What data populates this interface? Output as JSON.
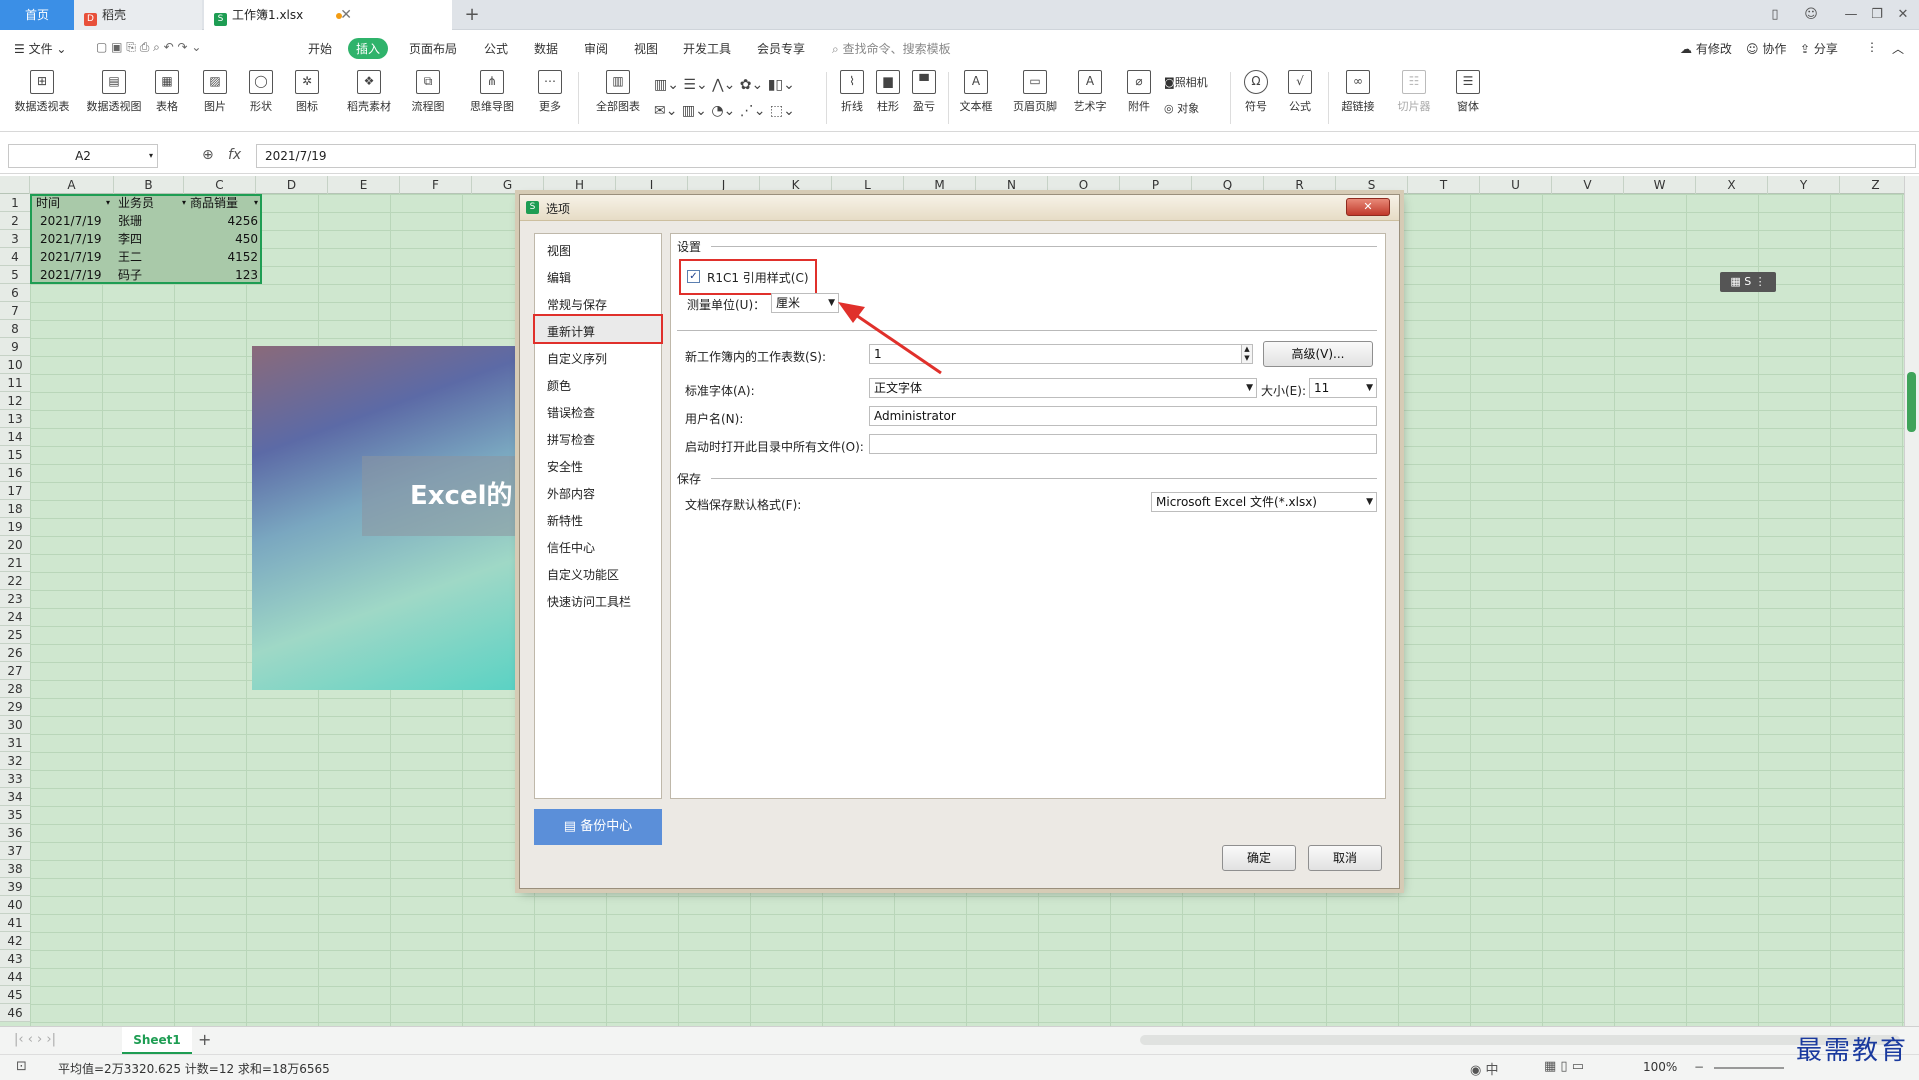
{
  "tabs": {
    "home": "首页",
    "daoke": "稻壳",
    "workbook": "工作簿1.xlsx"
  },
  "menu": {
    "file": "文件",
    "items": [
      "开始",
      "插入",
      "页面布局",
      "公式",
      "数据",
      "审阅",
      "视图",
      "开发工具",
      "会员专享"
    ],
    "search_placeholder": "查找命令、搜索模板",
    "has_changes": "有修改",
    "collab": "协作",
    "share": "分享"
  },
  "ribbon": [
    "数据透视表",
    "数据透视图",
    "表格",
    "图片",
    "形状",
    "图标",
    "稻壳素材",
    "流程图",
    "思维导图",
    "更多",
    "全部图表",
    "折线",
    "柱形",
    "盈亏",
    "文本框",
    "页眉页脚",
    "艺术字",
    "附件",
    "照相机",
    "对象",
    "符号",
    "公式",
    "超链接",
    "切片器",
    "窗体"
  ],
  "formula": {
    "cell_ref": "A2",
    "fx": "fx",
    "value": "2021/7/19"
  },
  "columns": [
    "A",
    "B",
    "C",
    "D",
    "E",
    "F",
    "G",
    "H",
    "I",
    "J",
    "K",
    "L",
    "M",
    "N",
    "O",
    "P",
    "Q",
    "R",
    "S",
    "T",
    "U",
    "V",
    "W",
    "X",
    "Y",
    "Z"
  ],
  "rows": [
    "1",
    "2",
    "3",
    "4",
    "5",
    "6",
    "7",
    "8",
    "9",
    "10",
    "11",
    "12",
    "13",
    "14",
    "15",
    "16",
    "17",
    "18",
    "19",
    "20",
    "21",
    "22",
    "23",
    "24",
    "25",
    "26",
    "27",
    "28",
    "29",
    "30",
    "31",
    "32",
    "33",
    "34",
    "35",
    "36",
    "37",
    "38",
    "39",
    "40",
    "41",
    "42",
    "43",
    "44",
    "45",
    "46"
  ],
  "table": {
    "headers": [
      "时间",
      "业务员",
      "商品销量"
    ],
    "data": [
      [
        "2021/7/19",
        "张珊",
        "4256"
      ],
      [
        "2021/7/19",
        "李四",
        "450"
      ],
      [
        "2021/7/19",
        "王二",
        "4152"
      ],
      [
        "2021/7/19",
        "码子",
        "123"
      ]
    ]
  },
  "picture_text": "Excel的",
  "sheet_tab": "Sheet1",
  "status": {
    "summary": "平均值=2万3320.625  计数=12  求和=18万6565",
    "zoom": "100%"
  },
  "watermark": "最需教育",
  "dialog": {
    "title": "选项",
    "nav": [
      "视图",
      "编辑",
      "常规与保存",
      "重新计算",
      "自定义序列",
      "颜色",
      "错误检查",
      "拼写检查",
      "安全性",
      "外部内容",
      "新特性",
      "信任中心",
      "自定义功能区",
      "快速访问工具栏"
    ],
    "backup": "备份中心",
    "settings_title": "设置",
    "r1c1_label": "R1C1 引用样式(C)",
    "r1c1_checked": true,
    "unit_label": "测量单位(U)：",
    "unit_value": "厘米",
    "sheets_label": "新工作簿内的工作表数(S):",
    "sheets_value": "1",
    "advanced": "高级(V)...",
    "font_label": "标准字体(A):",
    "font_value": "正文字体",
    "size_label": "大小(E):",
    "size_value": "11",
    "user_label": "用户名(N):",
    "user_value": "Administrator",
    "startup_label": "启动时打开此目录中所有文件(O):",
    "startup_value": "",
    "save_title": "保存",
    "format_label": "文档保存默认格式(F):",
    "format_value": "Microsoft Excel 文件(*.xlsx)",
    "ok": "确定",
    "cancel": "取消"
  },
  "colors": {
    "accent": "#2fb36b",
    "highlight": "#e0302b",
    "sheet_bg": "#cfe7cf"
  }
}
